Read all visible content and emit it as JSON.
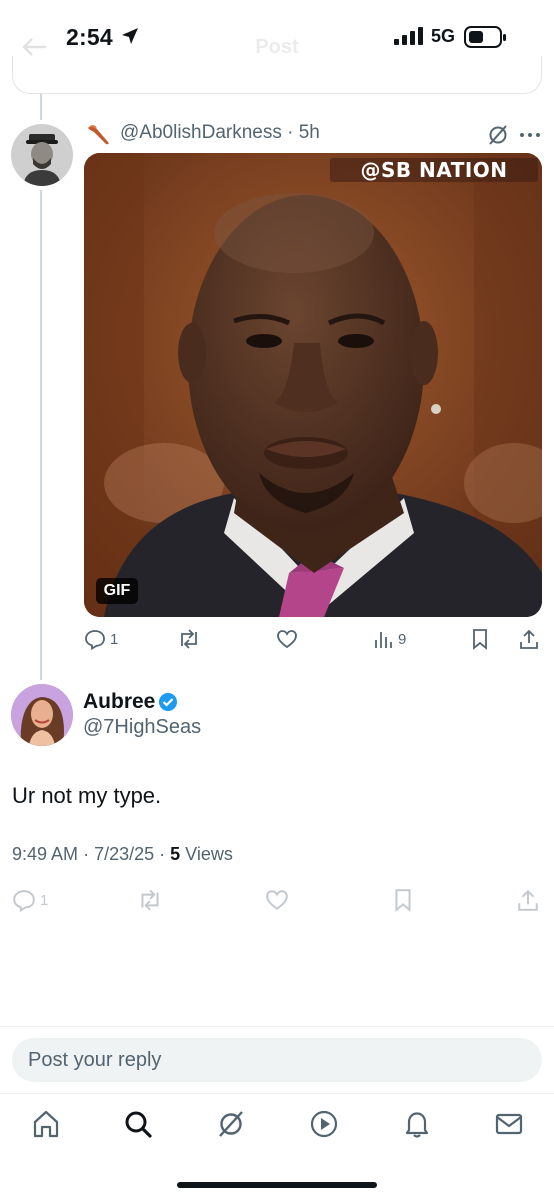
{
  "status_bar": {
    "time": "2:54",
    "network": "5G"
  },
  "header": {
    "title": "Post"
  },
  "parent_post": {
    "handle_line": "@Ab0lishDarkness · 5h",
    "media_watermark": "@SB NATION",
    "media_badge": "GIF",
    "actions": {
      "replies": "1",
      "reposts": "",
      "likes": "",
      "views": "9"
    }
  },
  "reply_post": {
    "display_name": "Aubree",
    "handle": "@7HighSeas",
    "text": "Ur not my type.",
    "time": "9:49 AM",
    "date": "7/23/25",
    "views_count": "5",
    "views_label": "Views",
    "actions": {
      "replies": "1"
    }
  },
  "composer": {
    "placeholder": "Post your reply"
  },
  "tabbar": {
    "items": [
      "home-icon",
      "search-icon",
      "grok-icon",
      "video-icon",
      "notifications-icon",
      "messages-icon"
    ]
  },
  "colors": {
    "text": "#0f1419",
    "secondary": "#536471",
    "verified": "#1d9bf0",
    "divider": "#eff3f4",
    "thread_line": "#cfd9de"
  }
}
